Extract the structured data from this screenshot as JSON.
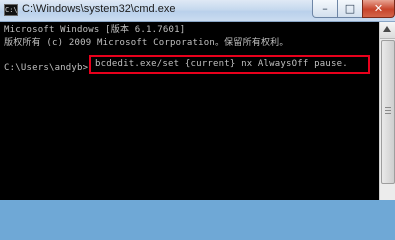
{
  "window": {
    "title": "C:\\Windows\\system32\\cmd.exe",
    "icon_label": "C:\\",
    "controls": {
      "minimize": "–",
      "maximize": "□",
      "close": "✕"
    }
  },
  "console": {
    "lines": [
      "Microsoft Windows [版本 6.1.7601]",
      "版权所有 (c) 2009 Microsoft Corporation。保留所有权利。",
      "C:\\Users\\andyb>"
    ],
    "command": "bcdedit.exe/set {current} nx AlwaysOff pause."
  },
  "colors": {
    "console_bg": "#000000",
    "console_text": "#c0c0c0",
    "highlight_border": "#e8001c"
  }
}
